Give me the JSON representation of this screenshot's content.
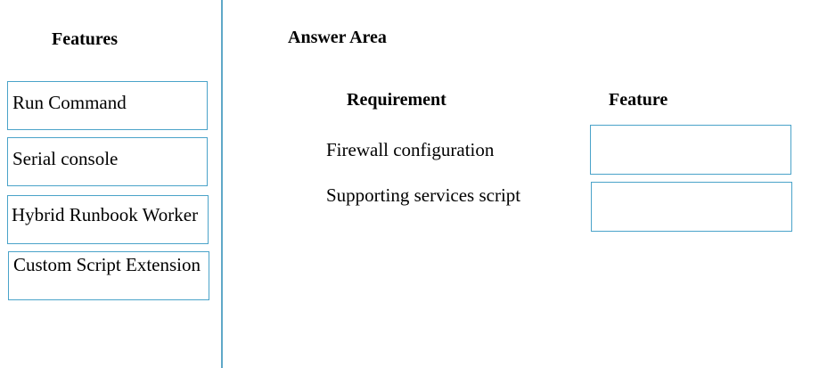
{
  "features_panel": {
    "title": "Features",
    "items": [
      {
        "label": "Run Command"
      },
      {
        "label": "Serial console"
      },
      {
        "label": "Hybrid Runbook Worker"
      },
      {
        "label": "Custom Script Extension"
      }
    ]
  },
  "answer_area": {
    "title": "Answer Area",
    "requirement_header": "Requirement",
    "feature_header": "Feature",
    "rows": [
      {
        "requirement": "Firewall configuration",
        "selected_feature": ""
      },
      {
        "requirement": "Supporting services script",
        "selected_feature": ""
      }
    ]
  },
  "colors": {
    "box_border": "#4aa3c9",
    "divider": "#5fa8c8"
  }
}
